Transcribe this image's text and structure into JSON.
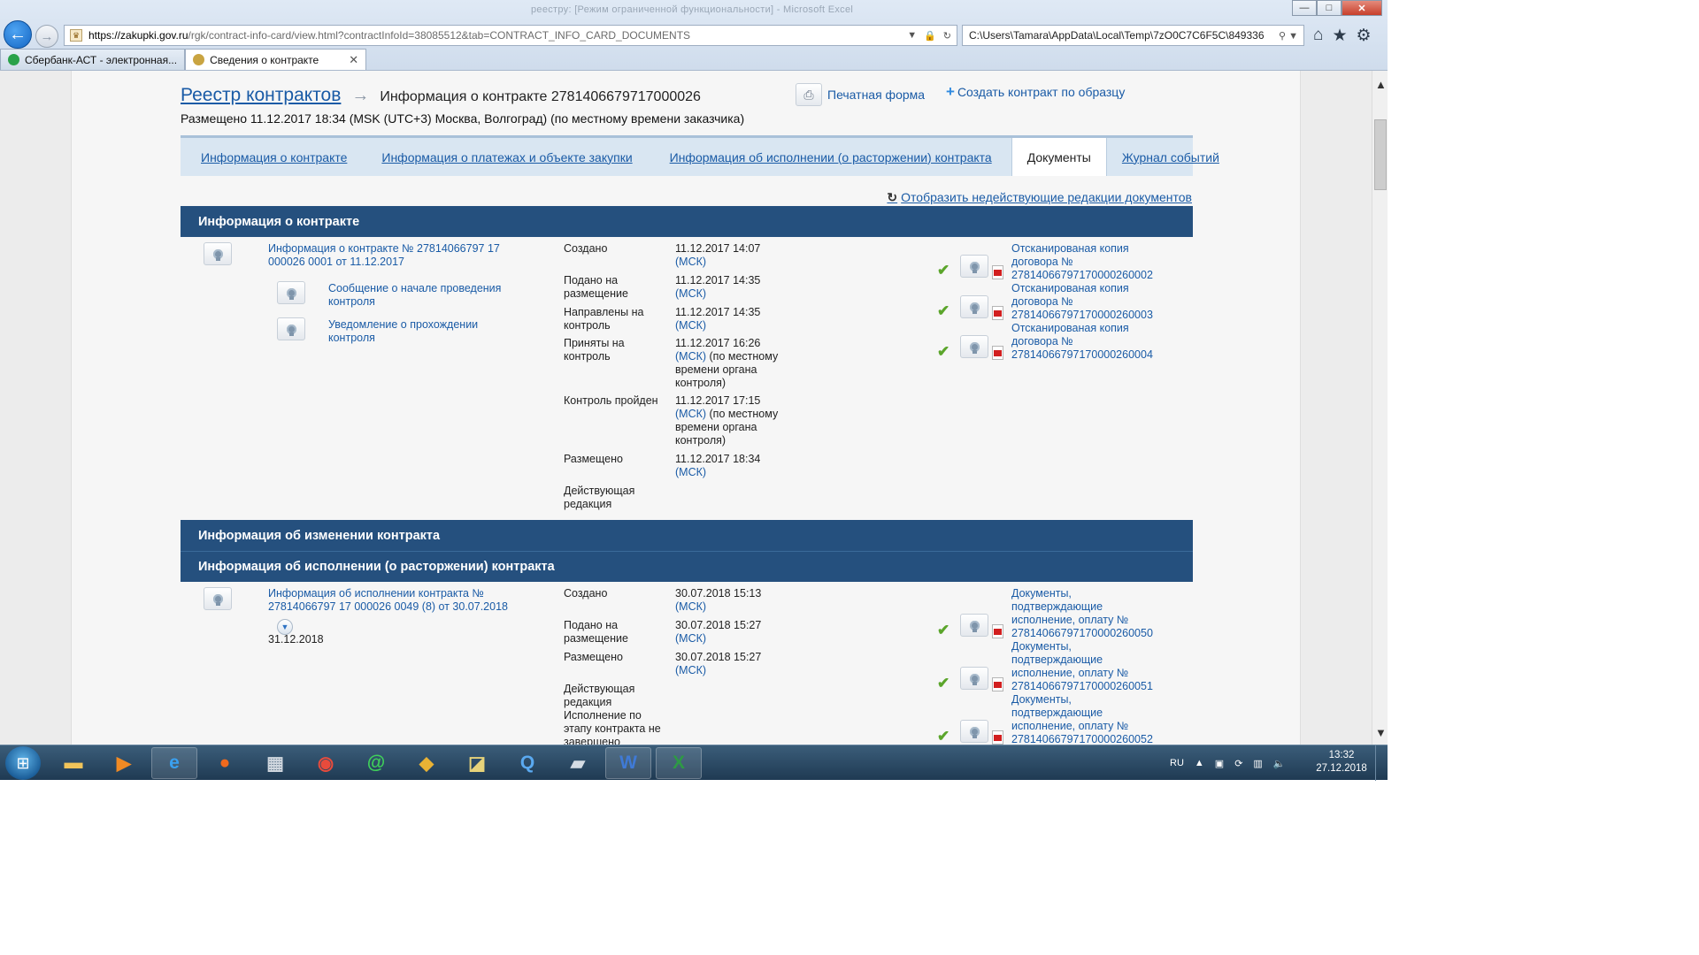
{
  "browser": {
    "window_title_faded": "реестру: [Режим ограниченной функциональности] - Microsoft Excel",
    "window_buttons": {
      "minimize": "—",
      "maximize": "□",
      "close": "✕"
    },
    "url_host": "https://zakupki.gov.ru",
    "url_path": "/rgk/contract-info-card/view.html?contractInfoId=38085512&tab=CONTRACT_INFO_CARD_DOCUMENTS",
    "second_address": "C:\\Users\\Tamara\\AppData\\Local\\Temp\\7zO0C7C6F5C\\849336",
    "tabs": [
      {
        "label": "Сбербанк-АСТ - электронная...",
        "active": false
      },
      {
        "label": "Сведения о контракте",
        "active": true
      }
    ]
  },
  "page": {
    "breadcrumb_root": "Реестр контрактов",
    "title": "Информация о контракте 2781406679717000026",
    "placed": "Размещено 11.12.2017 18:34 (MSK (UTC+3) Москва, Волгоград) (по местному времени заказчика)",
    "print_form": "Печатная форма",
    "create_by_sample": "Создать контракт по образцу",
    "tabs": [
      {
        "label": "Информация о контракте",
        "active": false
      },
      {
        "label": "Информация о платежах и объекте закупки",
        "active": false
      },
      {
        "label": "Информация об исполнении (о расторжении) контракта",
        "active": false
      },
      {
        "label": "Документы",
        "active": true
      },
      {
        "label": "Журнал событий",
        "active": false
      }
    ],
    "show_inactive": "Отобразить недействующие редакции документов"
  },
  "section1": {
    "header": "Информация о контракте",
    "doc_main": "Информация о контракте № 27814066797 17 000026 0001 от 11.12.2017",
    "sub_docs": [
      "Сообщение о начале проведения контроля",
      "Уведомление о прохождении контроля"
    ],
    "events": [
      {
        "label": "Создано",
        "date": "11.12.2017 14:07",
        "tz": "(МСК)",
        "note": ""
      },
      {
        "label": "Подано на размещение",
        "date": "11.12.2017 14:35",
        "tz": "(МСК)",
        "note": ""
      },
      {
        "label": "Направлены на контроль",
        "date": "11.12.2017 14:35",
        "tz": "(МСК)",
        "note": ""
      },
      {
        "label": "Приняты на контроль",
        "date": "11.12.2017 16:26",
        "tz": "(МСК)",
        "note": " (по местному времени органа контроля)"
      },
      {
        "label": "Контроль пройден",
        "date": "11.12.2017 17:15",
        "tz": "(МСК)",
        "note": " (по местному времени органа контроля)"
      },
      {
        "label": "Размещено",
        "date": "11.12.2017 18:34",
        "tz": "(МСК)",
        "note": ""
      },
      {
        "label": "Действующая редакция",
        "date": "",
        "tz": "",
        "note": ""
      }
    ],
    "attachments": [
      "Отсканированая копия договора № 27814066797170000260002",
      "Отсканированая копия договора № 27814066797170000260003",
      "Отсканированая копия договора № 27814066797170000260004"
    ]
  },
  "section2": {
    "header": "Информация об изменении контракта"
  },
  "section3": {
    "header": "Информация об исполнении (о расторжении) контракта",
    "doc_main": "Информация об исполнении контракта № 27814066797 17 000026 0049 (8) от 30.07.2018",
    "extra_date": "31.12.2018",
    "events": [
      {
        "label": "Создано",
        "date": "30.07.2018 15:13",
        "tz": "(МСК)"
      },
      {
        "label": "Подано на размещение",
        "date": "30.07.2018 15:27",
        "tz": "(МСК)"
      },
      {
        "label": "Размещено",
        "date": "30.07.2018 15:27",
        "tz": "(МСК)"
      },
      {
        "label": "Действующая редакция",
        "date": "",
        "tz": ""
      },
      {
        "label": "Исполнение по этапу контракта не завершено",
        "date": "",
        "tz": ""
      }
    ],
    "attachments": [
      "Документы, подтверждающие исполнение, оплату № 27814066797170000260050",
      "Документы, подтверждающие исполнение, оплату № 27814066797170000260051",
      "Документы, подтверждающие исполнение, оплату № 27814066797170000260052"
    ]
  },
  "taskbar": {
    "language": "RU",
    "time": "13:32",
    "date": "27.12.2018"
  },
  "colors": {
    "section_header_bg": "#25507e",
    "link": "#1a5ba6",
    "check": "#5ba52b"
  }
}
